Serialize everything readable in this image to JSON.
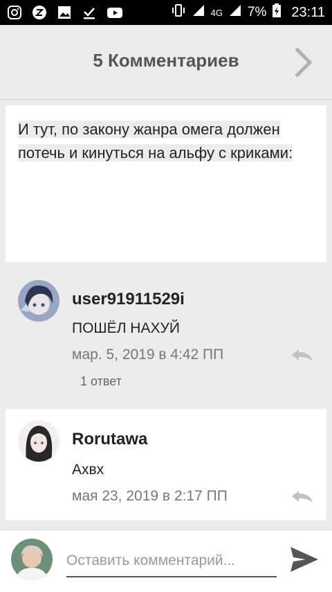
{
  "status_bar": {
    "network": "4G",
    "battery": "7%",
    "time": "23:11"
  },
  "header": {
    "title": "5 Комментариев"
  },
  "post": {
    "text": "И тут, по закону жанра омега должен потечь и кинуться на альфу с криками:"
  },
  "comments": [
    {
      "user": "user91911529i",
      "text": "ПОШЁЛ НАХУЙ",
      "date": "мар. 5, 2019 в 4:42 ПП",
      "replies": "1 ответ"
    },
    {
      "user": "Rorutawa",
      "text": "Ахвх",
      "date": "мая 23, 2019 в 2:17 ПП"
    }
  ],
  "composer": {
    "placeholder": "Оставить комментарий..."
  }
}
